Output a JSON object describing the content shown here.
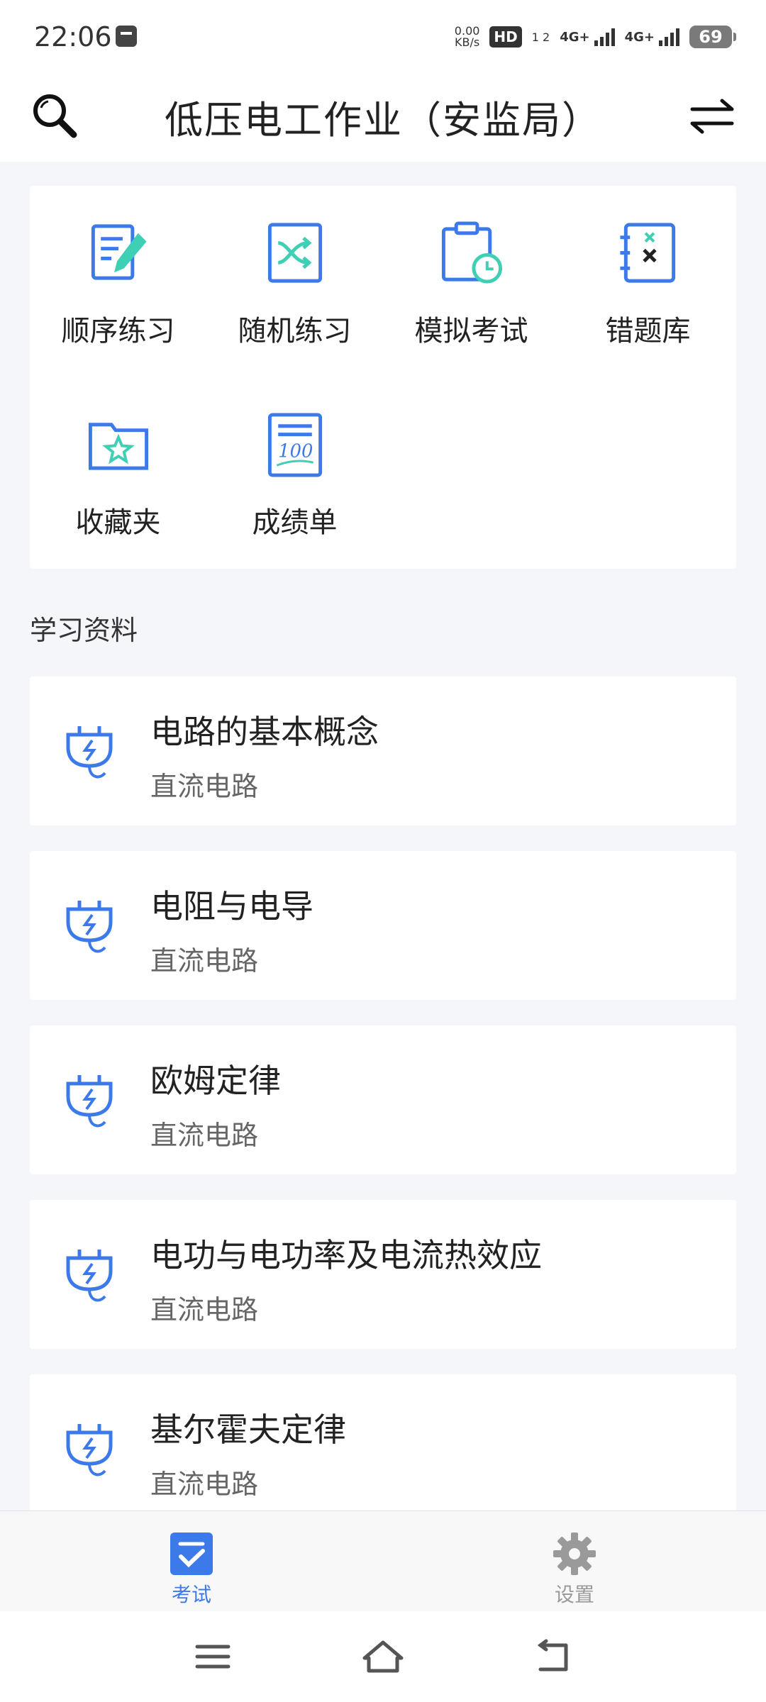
{
  "status_bar": {
    "time": "22:06",
    "net_speed_value": "0.00",
    "net_speed_unit": "KB/s",
    "hd_badge": "HD",
    "sim_numbers": "1 2",
    "network1": "4G+",
    "network2": "4G+",
    "battery": "69"
  },
  "header": {
    "title": "低压电工作业（安监局）",
    "search_icon": "search-icon",
    "switch_icon": "swap-arrows-icon"
  },
  "grid": {
    "items": [
      {
        "label": "顺序练习",
        "icon": "edit-document-icon"
      },
      {
        "label": "随机练习",
        "icon": "shuffle-icon"
      },
      {
        "label": "模拟考试",
        "icon": "clipboard-clock-icon"
      },
      {
        "label": "错题库",
        "icon": "wrong-notebook-icon"
      },
      {
        "label": "收藏夹",
        "icon": "star-folder-icon"
      },
      {
        "label": "成绩单",
        "icon": "score-sheet-icon"
      }
    ]
  },
  "section": {
    "title": "学习资料"
  },
  "materials": [
    {
      "title": "电路的基本概念",
      "subtitle": "直流电路",
      "icon": "plug-icon"
    },
    {
      "title": "电阻与电导",
      "subtitle": "直流电路",
      "icon": "plug-icon"
    },
    {
      "title": "欧姆定律",
      "subtitle": "直流电路",
      "icon": "plug-icon"
    },
    {
      "title": "电功与电功率及电流热效应",
      "subtitle": "直流电路",
      "icon": "plug-icon"
    },
    {
      "title": "基尔霍夫定律",
      "subtitle": "直流电路",
      "icon": "plug-icon"
    }
  ],
  "bottom_nav": {
    "tabs": [
      {
        "label": "考试",
        "icon": "exam-check-icon",
        "active": true
      },
      {
        "label": "设置",
        "icon": "gear-icon",
        "active": false
      }
    ]
  },
  "colors": {
    "accent": "#3b7ae8",
    "teal": "#3fcfb4",
    "background": "#f5f6fa"
  }
}
